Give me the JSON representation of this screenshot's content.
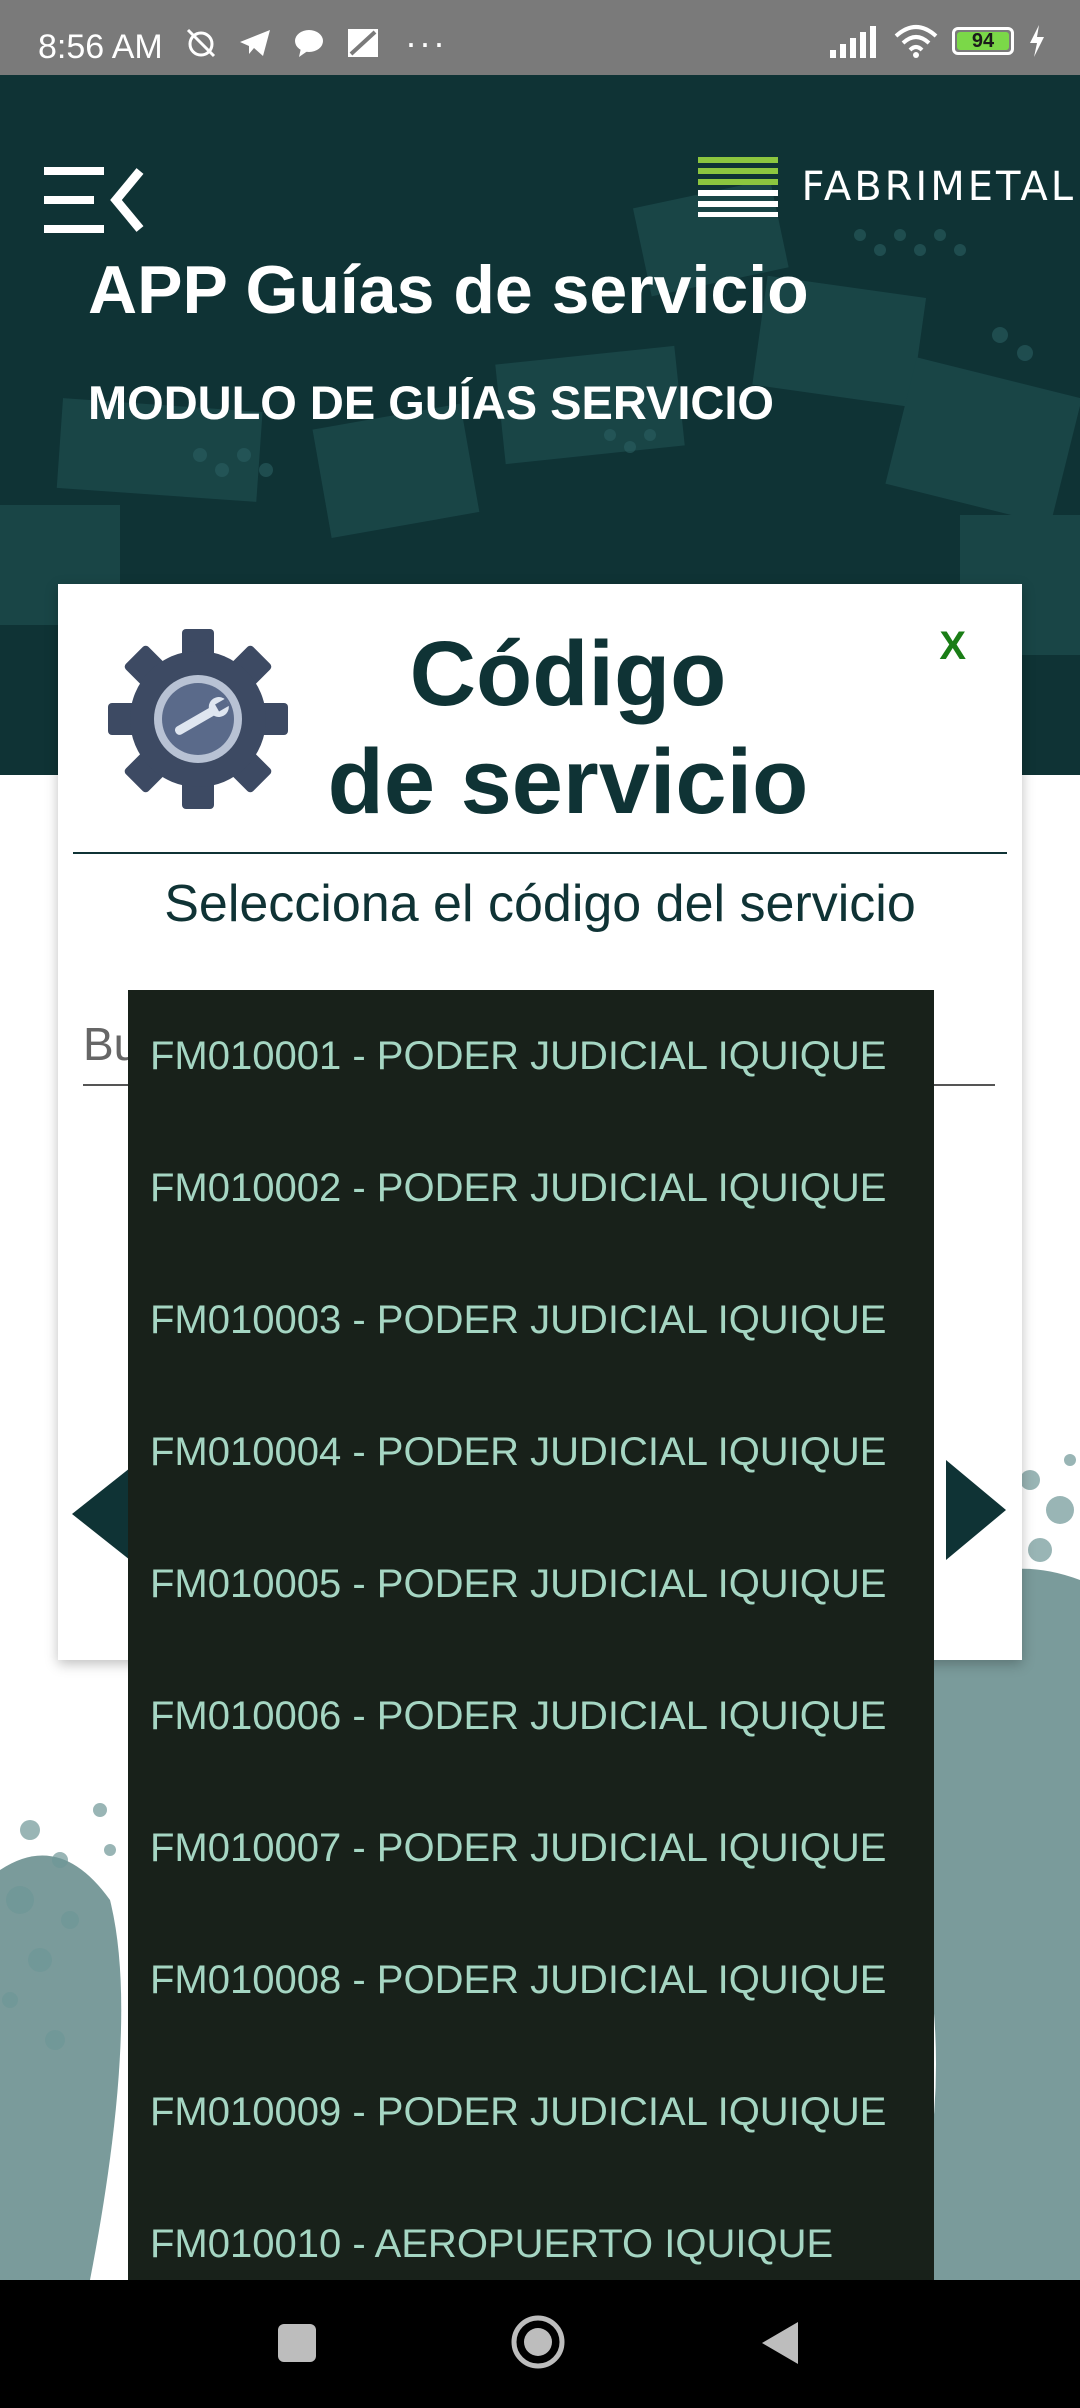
{
  "status_bar": {
    "time": "8:56 AM",
    "more": "···",
    "battery": "94"
  },
  "header": {
    "brand": "FABRIMETAL",
    "title": "APP Guías de servicio",
    "subtitle": "MODULO DE GUÍAS SERVICIO"
  },
  "modal": {
    "title_line1": "Código",
    "title_line2": "de servicio",
    "close_label": "X",
    "instruction": "Selecciona el código del servicio",
    "search_placeholder": "Buscar"
  },
  "dropdown": {
    "items": [
      "FM010001 - PODER JUDICIAL IQUIQUE",
      "FM010002 - PODER JUDICIAL IQUIQUE",
      "FM010003 - PODER JUDICIAL IQUIQUE",
      "FM010004 - PODER JUDICIAL IQUIQUE",
      "FM010005 - PODER JUDICIAL IQUIQUE",
      "FM010006 - PODER JUDICIAL IQUIQUE",
      "FM010007 - PODER JUDICIAL IQUIQUE",
      "FM010008 - PODER JUDICIAL IQUIQUE",
      "FM010009 - PODER JUDICIAL IQUIQUE",
      "FM010010 - AEROPUERTO IQUIQUE"
    ]
  },
  "colors": {
    "header_bg": "#0f3335",
    "dropdown_bg": "#18211a",
    "dropdown_text": "#a5d6c3",
    "close_color": "#1a7d16",
    "brand_green": "#8cc63f"
  }
}
